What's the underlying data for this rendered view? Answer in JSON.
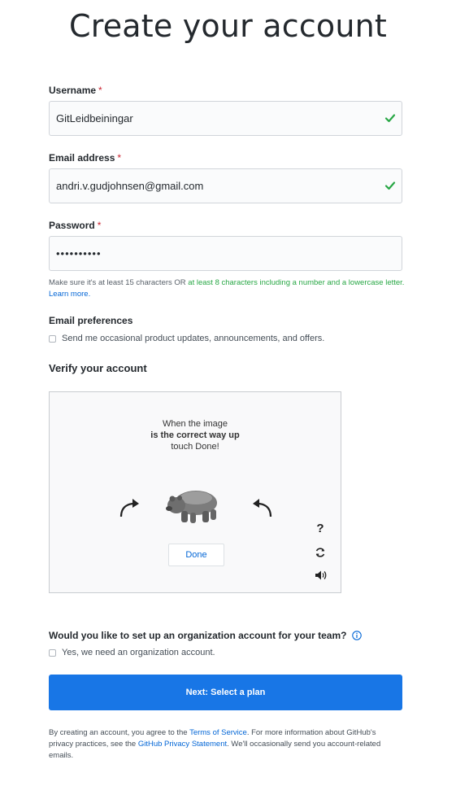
{
  "page": {
    "title": "Create your account"
  },
  "form": {
    "username": {
      "label": "Username",
      "required_mark": "*",
      "value": "GitLeidbeiningar"
    },
    "email": {
      "label": "Email address",
      "required_mark": "*",
      "value": "andri.v.gudjohnsen@gmail.com"
    },
    "password": {
      "label": "Password",
      "required_mark": "*",
      "value": "••••••••••"
    },
    "password_hint": {
      "part1": "Make sure it's at least 15 characters OR ",
      "part2": "at least 8 characters including a number and a lowercase letter.",
      "link": "Learn more."
    },
    "email_preferences": {
      "title": "Email preferences",
      "checkbox_label": "Send me occasional product updates, announcements, and offers."
    }
  },
  "verify": {
    "title": "Verify your account",
    "line1": "When the image",
    "line2": "is the correct way up",
    "line3": "touch Done!",
    "done_label": "Done",
    "help_glyph": "?"
  },
  "organization": {
    "question": "Would you like to set up an organization account for your team?",
    "checkbox_label": "Yes, we need an organization account."
  },
  "submit_label": "Next: Select a plan",
  "legal": {
    "part1": "By creating an account, you agree to the ",
    "tos_link": "Terms of Service",
    "part2": ". For more information about GitHub's privacy practices, see the ",
    "privacy_link": "GitHub Privacy Statement",
    "part3": ". We'll occasionally send you account-related emails."
  },
  "colors": {
    "accent": "#1876e6",
    "success": "#28a745",
    "link": "#0366d6",
    "required": "#cb2431"
  }
}
